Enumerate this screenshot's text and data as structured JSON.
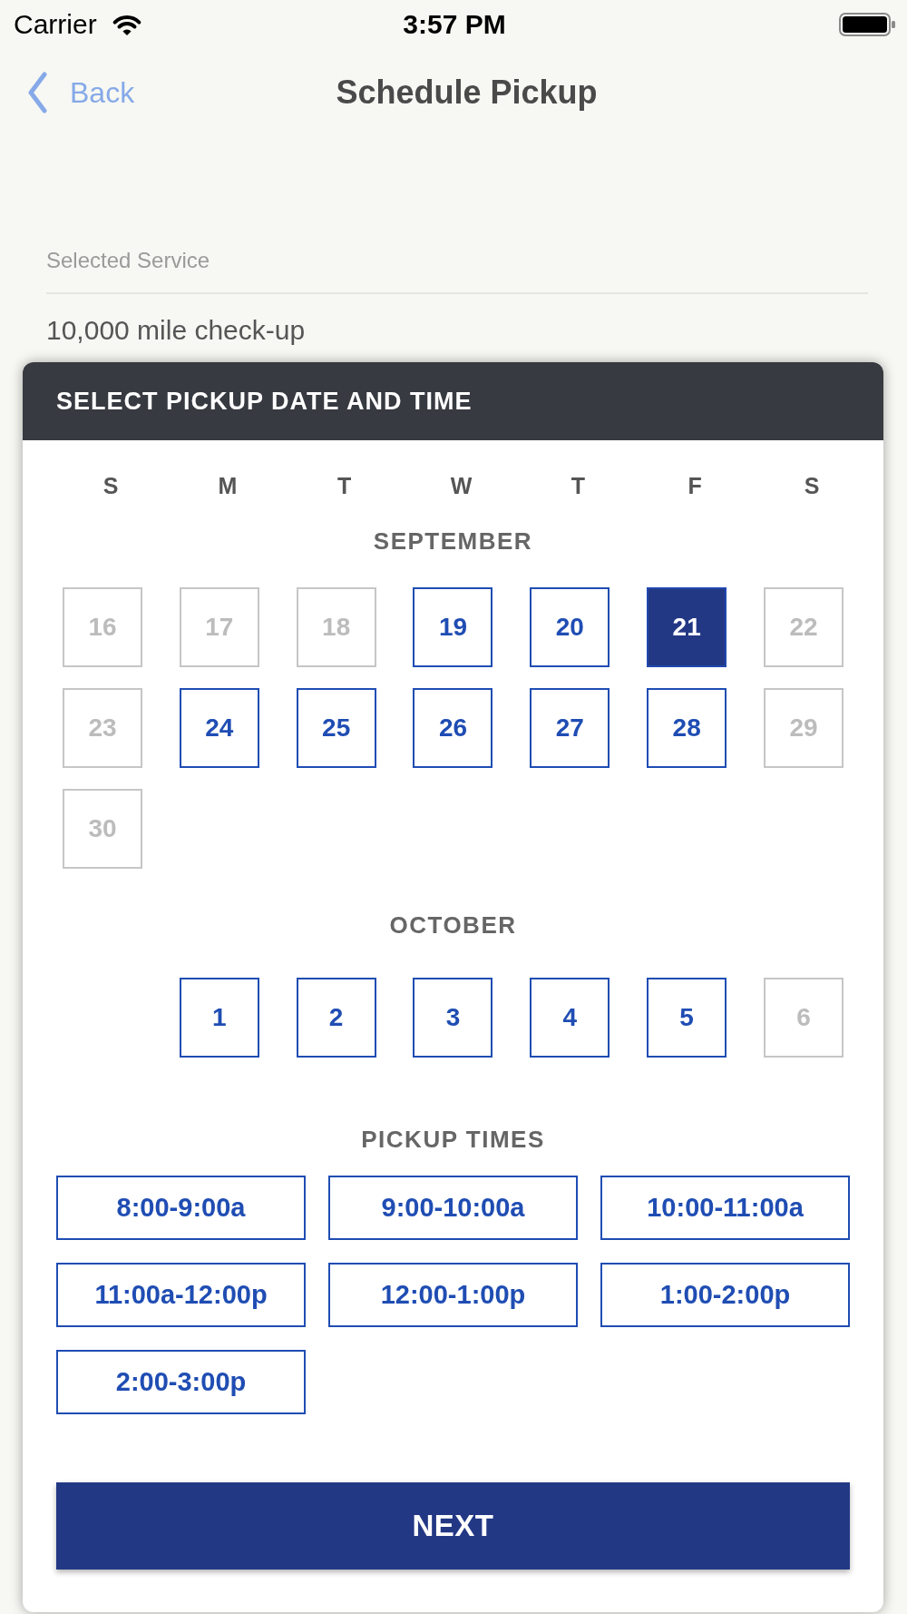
{
  "status_bar": {
    "carrier": "Carrier",
    "time": "3:57 PM"
  },
  "nav_bar": {
    "back": "Back",
    "title": "Schedule Pickup"
  },
  "service_field": {
    "label": "Selected Service",
    "value": "10,000 mile check-up"
  },
  "date_picker": {
    "title": "SELECT PICKUP DATE AND TIME",
    "weekdays": [
      "S",
      "M",
      "T",
      "W",
      "T",
      "F",
      "S"
    ],
    "months": [
      {
        "name": "SEPTEMBER",
        "weeks": [
          [
            {
              "kind": "day",
              "day": "16",
              "disabled": true,
              "selected": false
            },
            {
              "kind": "day",
              "day": "17",
              "disabled": true,
              "selected": false
            },
            {
              "kind": "day",
              "day": "18",
              "disabled": true,
              "selected": false
            },
            {
              "kind": "day",
              "day": "19",
              "disabled": false,
              "selected": false
            },
            {
              "kind": "day",
              "day": "20",
              "disabled": false,
              "selected": false
            },
            {
              "kind": "day",
              "day": "21",
              "disabled": false,
              "selected": true
            },
            {
              "kind": "day",
              "day": "22",
              "disabled": true,
              "selected": false
            }
          ],
          [
            {
              "kind": "day",
              "day": "23",
              "disabled": true,
              "selected": false
            },
            {
              "kind": "day",
              "day": "24",
              "disabled": false,
              "selected": false
            },
            {
              "kind": "day",
              "day": "25",
              "disabled": false,
              "selected": false
            },
            {
              "kind": "day",
              "day": "26",
              "disabled": false,
              "selected": false
            },
            {
              "kind": "day",
              "day": "27",
              "disabled": false,
              "selected": false
            },
            {
              "kind": "day",
              "day": "28",
              "disabled": false,
              "selected": false
            },
            {
              "kind": "day",
              "day": "29",
              "disabled": true,
              "selected": false
            }
          ],
          [
            {
              "kind": "day",
              "day": "30",
              "disabled": true,
              "selected": false
            }
          ]
        ]
      },
      {
        "name": "OCTOBER",
        "weeks": [
          [
            {
              "kind": "blank"
            },
            {
              "kind": "day",
              "day": "1",
              "disabled": false,
              "selected": false
            },
            {
              "kind": "day",
              "day": "2",
              "disabled": false,
              "selected": false
            },
            {
              "kind": "day",
              "day": "3",
              "disabled": false,
              "selected": false
            },
            {
              "kind": "day",
              "day": "4",
              "disabled": false,
              "selected": false
            },
            {
              "kind": "day",
              "day": "5",
              "disabled": false,
              "selected": false
            },
            {
              "kind": "day",
              "day": "6",
              "disabled": true,
              "selected": false
            }
          ]
        ]
      }
    ],
    "pickup_times": {
      "title": "PICKUP TIMES",
      "slots": [
        {
          "label": "8:00-9:00a",
          "selected": false
        },
        {
          "label": "9:00-10:00a",
          "selected": false
        },
        {
          "label": "10:00-11:00a",
          "selected": false
        },
        {
          "label": "11:00a-12:00p",
          "selected": false
        },
        {
          "label": "12:00-1:00p",
          "selected": false
        },
        {
          "label": "1:00-2:00p",
          "selected": false
        },
        {
          "label": "2:00-3:00p",
          "selected": false
        }
      ]
    },
    "next_button": "NEXT"
  }
}
